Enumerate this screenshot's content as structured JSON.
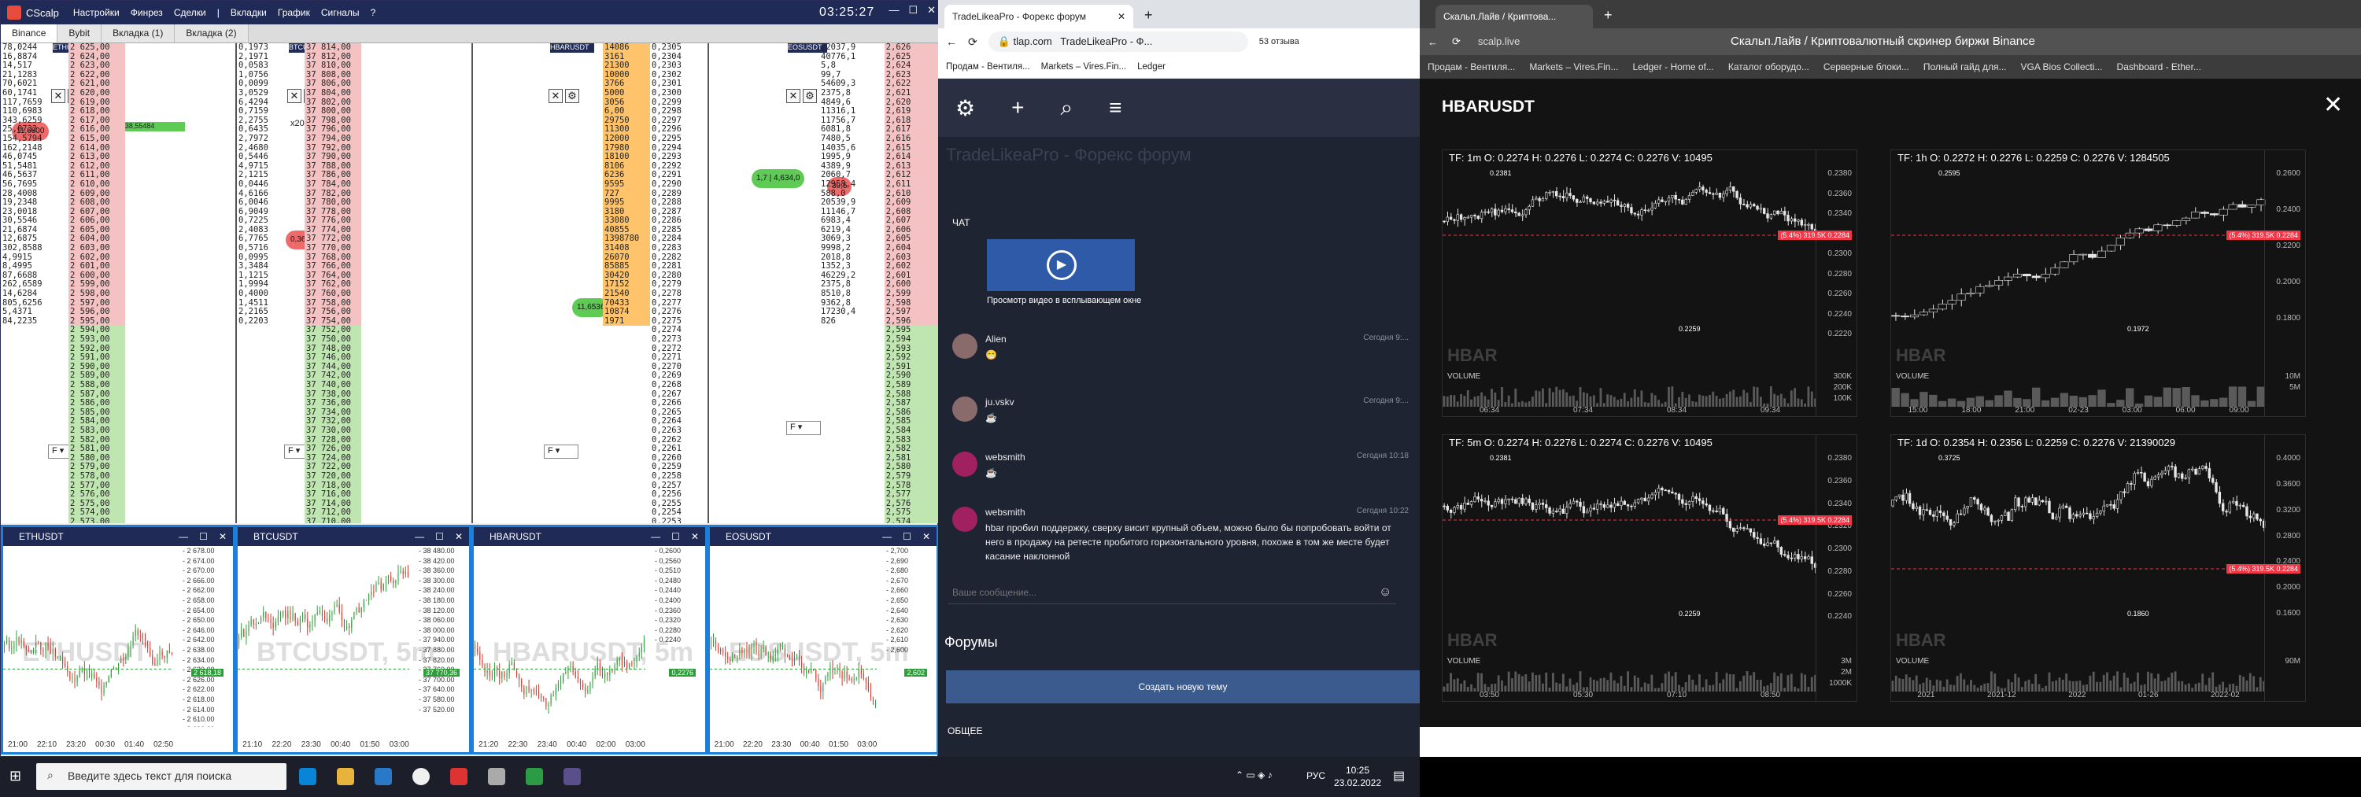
{
  "cscalp": {
    "app_title": "CScalp",
    "menu": [
      "Настройки",
      "Финрез",
      "Сделки",
      "|",
      "Вкладки",
      "График",
      "Сигналы",
      "?"
    ],
    "clock": "03:25:27",
    "tabs": [
      "Binance",
      "Bybit",
      "Вкладка (1)",
      "Вкладка (2)"
    ],
    "columns": [
      {
        "ticker": "ETHUSDT",
        "bubble": "11,6800",
        "bubble2": "1,59065 | 38,55484"
      },
      {
        "ticker": "BTCUSDT",
        "bubble": "0,363084",
        "x_label": "x200"
      },
      {
        "ticker": "HBARUSDT",
        "bubble": "11,6536",
        "sel_vol": "1398780",
        "sel_price": "0,2284"
      },
      {
        "ticker": "EOSUSDT",
        "bubble": "1,7 | 4,634,0",
        "bubble2": "39,5"
      }
    ],
    "dom_eth": [
      [
        "78,0244",
        "2 625,00"
      ],
      [
        "16,8874",
        "2 624,00"
      ],
      [
        "14,517",
        "2 623,00"
      ],
      [
        "21,1283",
        "2 622,00"
      ],
      [
        "70,6021",
        "2 621,00"
      ],
      [
        "60,1741",
        "2 620,00"
      ],
      [
        "117,7659",
        "2 619,00"
      ],
      [
        "110,6983",
        "2 618,00"
      ],
      [
        "343,6259",
        "2 617,00"
      ],
      [
        "25,8732",
        "2 616,00"
      ],
      [
        "154,5794",
        "2 615,00"
      ],
      [
        "162,2148",
        "2 614,00"
      ],
      [
        "46,0745",
        "2 613,00"
      ],
      [
        "51,5481",
        "2 612,00"
      ],
      [
        "46,5637",
        "2 611,00"
      ],
      [
        "56,7695",
        "2 610,00"
      ],
      [
        "28,4008",
        "2 609,00"
      ],
      [
        "19,2348",
        "2 608,00"
      ],
      [
        "23,0018",
        "2 607,00"
      ],
      [
        "30,5546",
        "2 606,00"
      ],
      [
        "21,6874",
        "2 605,00"
      ],
      [
        "12,6875",
        "2 604,00"
      ],
      [
        "302,8588",
        "2 603,00"
      ],
      [
        "4,9915",
        "2 602,00"
      ],
      [
        "8,4995",
        "2 601,00"
      ],
      [
        "87,6688",
        "2 600,00"
      ],
      [
        "262,6589",
        "2 599,00"
      ],
      [
        "14,6284",
        "2 598,00"
      ],
      [
        "805,6256",
        "2 597,00"
      ],
      [
        "5,4371",
        "2 596,00"
      ],
      [
        "84,2235",
        "2 595,00"
      ]
    ],
    "dom_eth_low": [
      "2 594,00",
      "2 593,00",
      "2 592,00",
      "2 591,00",
      "2 590,00",
      "2 589,00",
      "2 588,00",
      "2 587,00",
      "2 586,00",
      "2 585,00",
      "2 584,00",
      "2 583,00",
      "2 582,00",
      "2 581,00",
      "2 580,00",
      "2 579,00",
      "2 578,00",
      "2 577,00",
      "2 576,00",
      "2 575,00",
      "2 574,00",
      "2 573,00"
    ],
    "dom_btc": [
      [
        "0,1973",
        "37 814,00"
      ],
      [
        "2,1971",
        "37 812,00"
      ],
      [
        "0,0583",
        "37 810,00"
      ],
      [
        "1,0756",
        "37 808,00"
      ],
      [
        "0,0099",
        "37 806,00"
      ],
      [
        "3,0529",
        "37 804,00"
      ],
      [
        "6,4294",
        "37 802,00"
      ],
      [
        "0,7159",
        "37 800,00"
      ],
      [
        "2,2755",
        "37 798,00"
      ],
      [
        "0,6435",
        "37 796,00"
      ],
      [
        "2,7972",
        "37 794,00"
      ],
      [
        "2,4680",
        "37 792,00"
      ],
      [
        "0,5446",
        "37 790,00"
      ],
      [
        "4,9715",
        "37 788,00"
      ],
      [
        "2,1215",
        "37 786,00"
      ],
      [
        "0,0446",
        "37 784,00"
      ],
      [
        "4,6166",
        "37 782,00"
      ],
      [
        "6,0046",
        "37 780,00"
      ],
      [
        "6,9049",
        "37 778,00"
      ],
      [
        "0,7225",
        "37 776,00"
      ],
      [
        "2,4083",
        "37 774,00"
      ],
      [
        "6,7765",
        "37 772,00"
      ],
      [
        "0,5716",
        "37 770,00"
      ],
      [
        "0,0995",
        "37 768,00"
      ],
      [
        "3,3484",
        "37 766,00"
      ],
      [
        "1,1215",
        "37 764,00"
      ],
      [
        "1,9994",
        "37 762,00"
      ],
      [
        "0,4000",
        "37 760,00"
      ],
      [
        "1,4511",
        "37 758,00"
      ],
      [
        "2,2165",
        "37 756,00"
      ],
      [
        "0,2203",
        "37 754,00"
      ]
    ],
    "dom_btc_low": [
      "37 752,00",
      "37 750,00",
      "37 748,00",
      "37 746,00",
      "37 744,00",
      "37 742,00",
      "37 740,00",
      "37 738,00",
      "37 736,00",
      "37 734,00",
      "37 732,00",
      "37 730,00",
      "37 728,00",
      "37 726,00",
      "37 724,00",
      "37 722,00",
      "37 720,00",
      "37 718,00",
      "37 716,00",
      "37 714,00",
      "37 712,00",
      "37 710,00"
    ],
    "dom_hbar": [
      [
        "14086",
        "0,2305"
      ],
      [
        "3161",
        "0,2304"
      ],
      [
        "21300",
        "0,2303"
      ],
      [
        "10000",
        "0,2302"
      ],
      [
        "3766",
        "0,2301"
      ],
      [
        "5000",
        "0,2300"
      ],
      [
        "3056",
        "0,2299"
      ],
      [
        "6,00",
        "0,2298"
      ],
      [
        "29750",
        "0,2297"
      ],
      [
        "11300",
        "0,2296"
      ],
      [
        "12000",
        "0,2295"
      ],
      [
        "17980",
        "0,2294"
      ],
      [
        "18100",
        "0,2293"
      ],
      [
        "8106",
        "0,2292"
      ],
      [
        "6236",
        "0,2291"
      ],
      [
        "9595",
        "0,2290"
      ],
      [
        "727",
        "0,2289"
      ],
      [
        "9995",
        "0,2288"
      ],
      [
        "3180",
        "0,2287"
      ],
      [
        "33080",
        "0,2286"
      ],
      [
        "40855",
        "0,2285"
      ],
      [
        "1398780",
        "0,2284"
      ],
      [
        "31408",
        "0,2283"
      ],
      [
        "26070",
        "0,2282"
      ],
      [
        "85885",
        "0,2281"
      ],
      [
        "30420",
        "0,2280"
      ],
      [
        "17152",
        "0,2279"
      ],
      [
        "21540",
        "0,2278"
      ],
      [
        "70433",
        "0,2277"
      ],
      [
        "10874",
        "0,2276"
      ],
      [
        "1971",
        "0,2275"
      ]
    ],
    "dom_hbar_low": [
      "0,2274",
      "0,2273",
      "0,2272",
      "0,2271",
      "0,2270",
      "0,2269",
      "0,2268",
      "0,2267",
      "0,2266",
      "0,2265",
      "0,2264",
      "0,2263",
      "0,2262",
      "0,2261",
      "0,2260",
      "0,2259",
      "0,2258",
      "0,2257",
      "0,2256",
      "0,2255",
      "0,2254",
      "0,2253"
    ],
    "dom_eos": [
      [
        "22037,9",
        "2,626"
      ],
      [
        "40776,1",
        "2,625"
      ],
      [
        "5,8",
        "2,624"
      ],
      [
        "99,7",
        "2,623"
      ],
      [
        "54609,3",
        "2,622"
      ],
      [
        "2375,8",
        "2,621"
      ],
      [
        "4849,6",
        "2,620"
      ],
      [
        "11316,1",
        "2,619"
      ],
      [
        "11756,7",
        "2,618"
      ],
      [
        "6081,8",
        "2,617"
      ],
      [
        "7480,5",
        "2,616"
      ],
      [
        "14035,6",
        "2,615"
      ],
      [
        "1995,9",
        "2,614"
      ],
      [
        "4389,9",
        "2,613"
      ],
      [
        "2060,7",
        "2,612"
      ],
      [
        "12958,4",
        "2,611"
      ],
      [
        "588,0",
        "2,610"
      ],
      [
        "20539,9",
        "2,609"
      ],
      [
        "11146,7",
        "2,608"
      ],
      [
        "6983,4",
        "2,607"
      ],
      [
        "6219,4",
        "2,606"
      ],
      [
        "3069,3",
        "2,605"
      ],
      [
        "9998,2",
        "2,604"
      ],
      [
        "2018,8",
        "2,603"
      ],
      [
        "1352,3",
        "2,602"
      ],
      [
        "46229,2",
        "2,601"
      ],
      [
        "2375,8",
        "2,600"
      ],
      [
        "8510,8",
        "2,599"
      ],
      [
        "9362,8",
        "2,598"
      ],
      [
        "17230,4",
        "2,597"
      ],
      [
        "826",
        "2,596"
      ]
    ],
    "dom_eos_low": [
      "2,595",
      "2,594",
      "2,593",
      "2,592",
      "2,591",
      "2,590",
      "2,589",
      "2,588",
      "2,587",
      "2,586",
      "2,585",
      "2,584",
      "2,583",
      "2,582",
      "2,581",
      "2,580",
      "2,579",
      "2,578",
      "2,577",
      "2,576",
      "2,575",
      "2,574"
    ],
    "panels": [
      {
        "name": "ETHUSDT",
        "wm": "ETHUSDT",
        "price": "2 618,18",
        "ticks": [
          "2 678.00",
          "2 674.00",
          "2 670.00",
          "2 666.00",
          "2 662.00",
          "2 658.00",
          "2 654.00",
          "2 650.00",
          "2 646.00",
          "2 642.00",
          "2 638.00",
          "2 634.00",
          "2 630.00",
          "2 626.00",
          "2 622.00",
          "2 618.00",
          "2 614.00",
          "2 610.00",
          "2 606.00",
          "2 602.00"
        ],
        "times": [
          "21:00",
          "22:10",
          "23:20",
          "00:30",
          "01:40",
          "02:50"
        ]
      },
      {
        "name": "BTCUSDT",
        "wm": "BTCUSDT, 5m",
        "price": "37 770,36",
        "ticks": [
          "38 480.00",
          "38 420.00",
          "38 360.00",
          "38 300.00",
          "38 240.00",
          "38 180.00",
          "38 120.00",
          "38 060.00",
          "38 000.00",
          "37 940.00",
          "37 880.00",
          "37 820.00",
          "37 760.00",
          "37 700.00",
          "37 640.00",
          "37 580.00",
          "37 520.00"
        ],
        "times": [
          "21:10",
          "22:20",
          "23:30",
          "00:40",
          "01:50",
          "03:00"
        ]
      },
      {
        "name": "HBARUSDT",
        "wm": "HBARUSDT, 5m",
        "price": "0,2276",
        "ticks": [
          "0,2600",
          "0,2560",
          "0,2510",
          "0,2480",
          "0,2440",
          "0,2400",
          "0,2360",
          "0,2320",
          "0,2280",
          "0,2240"
        ],
        "times": [
          "21:20",
          "22:30",
          "23:40",
          "00:40",
          "02:00",
          "03:00"
        ]
      },
      {
        "name": "EOSUSDT",
        "wm": "EOSUSDT, 5m",
        "price": "2,602",
        "ticks": [
          "2,700",
          "2,690",
          "2,680",
          "2,670",
          "2,660",
          "2,650",
          "2,640",
          "2,630",
          "2,620",
          "2,610",
          "2,600"
        ],
        "times": [
          "21:00",
          "22:20",
          "23:30",
          "00:40",
          "01:50",
          "03:00"
        ]
      }
    ]
  },
  "browser1": {
    "tab_title": "TradeLikeaPro - Форекс форум",
    "url": "tlap.com",
    "page_title_bar": "TradeLikeaPro - Ф...",
    "reviews": "53 отзыва",
    "bookmarks": [
      "Продам - Вентиля...",
      "Markets – Vires.Fin...",
      "Ledger"
    ],
    "brand": "TradeLikeaPro - Форекс форум",
    "chat_label": "ЧАТ",
    "video_caption": "Просмотр видео в всплывающем окне",
    "messages": [
      {
        "name": "Alien",
        "time": "Сегодня 9:...",
        "text": "😁"
      },
      {
        "name": "ju.vskv",
        "time": "Сегодня 9:...",
        "text": "☕"
      },
      {
        "name": "websmith",
        "time": "Сегодня 10:18",
        "text": "☕"
      },
      {
        "name": "websmith",
        "time": "Сегодня 10:22",
        "text": "hbar пробил поддержку, сверху висит крупный объем, можно было бы попробовать войти от него в продажу на ретесте пробитого горизонтального уровня, похоже в том же месте будет касание наклонной"
      }
    ],
    "message_placeholder": "Ваше сообщение...",
    "forums": "Форумы",
    "new_topic": "Создать новую тему",
    "general": "ОБЩЕЕ"
  },
  "browser2": {
    "tab_title": "Скальп.Лайв / Криптова...",
    "url": "scalp.live",
    "page_title": "Скальп.Лайв / Криптовалютный скринер биржи Binance",
    "bookmarks": [
      "Продам - Вентиля...",
      "Markets – Vires.Fin...",
      "Ledger - Home of...",
      "Каталог оборудо...",
      "Серверные блоки...",
      "Полный гайд для...",
      "VGA Bios Collecti...",
      "Dashboard - Ether..."
    ],
    "heading": "HBARUSDT",
    "close": "✕",
    "charts": [
      {
        "tf": "TF: 1m",
        "o": "O: 0.2274",
        "h": "H: 0.2276",
        "l": "L: 0.2274",
        "c": "C: 0.2276",
        "v": "V: 10495",
        "wm": "HBAR",
        "vol": "VOLUME",
        "peak": "0.2381",
        "low": "0.2259",
        "level": "(5.4%) 319.5K 0.2284",
        "prices": [
          "0.2380",
          "0.2360",
          "0.2340",
          "0.2320",
          "0.2300",
          "0.2280",
          "0.2260",
          "0.2240",
          "0.2220"
        ],
        "vols": [
          "300K",
          "200K",
          "100K"
        ],
        "times": [
          "06:34",
          "07:34",
          "08:34",
          "09:34"
        ]
      },
      {
        "tf": "TF: 1h",
        "o": "O: 0.2272",
        "h": "H: 0.2276",
        "l": "L: 0.2259",
        "c": "C: 0.2276",
        "v": "V: 1284505",
        "wm": "HBAR",
        "vol": "VOLUME",
        "peak": "0.2595",
        "low": "0.1972",
        "level": "(5.4%) 319.5K 0.2284",
        "prices": [
          "0.2600",
          "0.2400",
          "0.2200",
          "0.2000",
          "0.1800"
        ],
        "vols": [
          "10M",
          "5M"
        ],
        "times": [
          "15:00",
          "18:00",
          "21:00",
          "02-23",
          "03:00",
          "06:00",
          "09:00"
        ]
      },
      {
        "tf": "TF: 5m",
        "o": "O: 0.2274",
        "h": "H: 0.2276",
        "l": "L: 0.2274",
        "c": "C: 0.2276",
        "v": "V: 10495",
        "wm": "HBAR",
        "vol": "VOLUME",
        "peak": "0.2381",
        "low": "0.2259",
        "level": "(5.4%) 319.5K 0.2284",
        "prices": [
          "0.2380",
          "0.2360",
          "0.2340",
          "0.2320",
          "0.2300",
          "0.2280",
          "0.2260",
          "0.2240"
        ],
        "vols": [
          "3M",
          "2M",
          "1000K"
        ],
        "times": [
          "03:50",
          "05:30",
          "07:10",
          "08:50"
        ]
      },
      {
        "tf": "TF: 1d",
        "o": "O: 0.2354",
        "h": "H: 0.2356",
        "l": "L: 0.2259",
        "c": "C: 0.2276",
        "v": "V: 21390029",
        "wm": "HBAR",
        "vol": "VOLUME",
        "peak": "0.3725",
        "low": "0.1860",
        "level": "(5.4%) 319.5K 0.2284",
        "prices": [
          "0.4000",
          "0.3600",
          "0.3200",
          "0.2800",
          "0.2400",
          "0.2000",
          "0.1600"
        ],
        "vols": [
          "90M"
        ],
        "times": [
          "2021",
          "2021-12",
          "2022",
          "01-26",
          "2022-02"
        ]
      }
    ]
  },
  "taskbar": {
    "search_placeholder": "Введите здесь текст для поиска",
    "lang": "РУС",
    "time": "10:25",
    "date": "23.02.2022"
  },
  "colors": {
    "ask": "#f4c2c2",
    "bid": "#bfe6b0",
    "hbar_ask": "#ffc46b",
    "bar_green": "#5ecb55",
    "bar_red": "#e84b3c",
    "win_title": "#1f2a56",
    "accent": "#1c7fd9",
    "level": "#f23645"
  }
}
